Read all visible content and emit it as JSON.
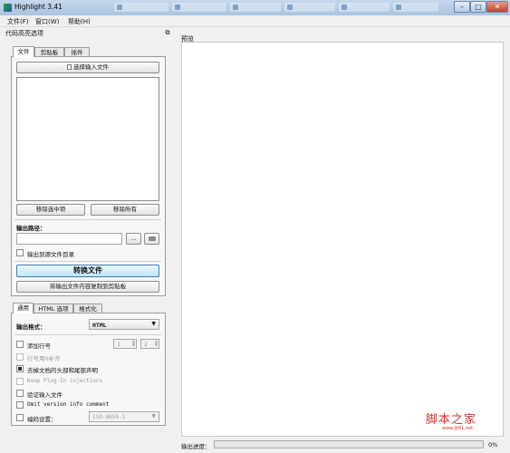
{
  "window": {
    "title": "Highlight 3.41",
    "taskbar_ghosts": [
      "",
      "",
      "",
      "",
      "",
      ""
    ]
  },
  "menu": [
    "文件(F)",
    "窗口(W)",
    "帮助(H)"
  ],
  "left_dock": {
    "title": "代码高亮选项",
    "top_tabs": [
      "文件",
      "剪贴板",
      "插件"
    ],
    "select_input_label": "选择输入文件",
    "remove_selected_label": "移除选中项",
    "remove_all_label": "移除所有",
    "output_path_label": "输出路径：",
    "output_path_value": "",
    "browse_label": "...",
    "output_to_source_label": "输出到源文件目录",
    "convert_label": "转换文件",
    "copy_to_clipboard_label": "将输出文件内容复制到剪贴板",
    "bottom_tabs": [
      "通用",
      "HTML 选项",
      "格式化"
    ],
    "output_format_label": "输出格式：",
    "output_format_value": "HTML",
    "add_line_numbers_label": "添加行号",
    "line_number_start": "1",
    "line_number_width": "2",
    "line_number_zero_pad_label": "行号用0补齐",
    "omit_header_footer_label": "去掉文档的头部和尾部声明",
    "keep_plugin_injections_label": "Keep Plug-In injections",
    "validate_input_label": "验证输入文件",
    "omit_version_comment_label": "Omit version info comment",
    "encoding_label": "编码设置：",
    "encoding_value": "ISO-8859-1"
  },
  "preview": {
    "title": "预览",
    "progress_label": "输出进度：",
    "progress_value": "0%",
    "progress_fraction": 0
  },
  "watermark": {
    "text": "脚本之家",
    "url": "www.jb51.net"
  },
  "colors": {
    "titlebar": "#bcd0e6",
    "progress_fill": "#5ab34a",
    "watermark": "#d2322d"
  }
}
